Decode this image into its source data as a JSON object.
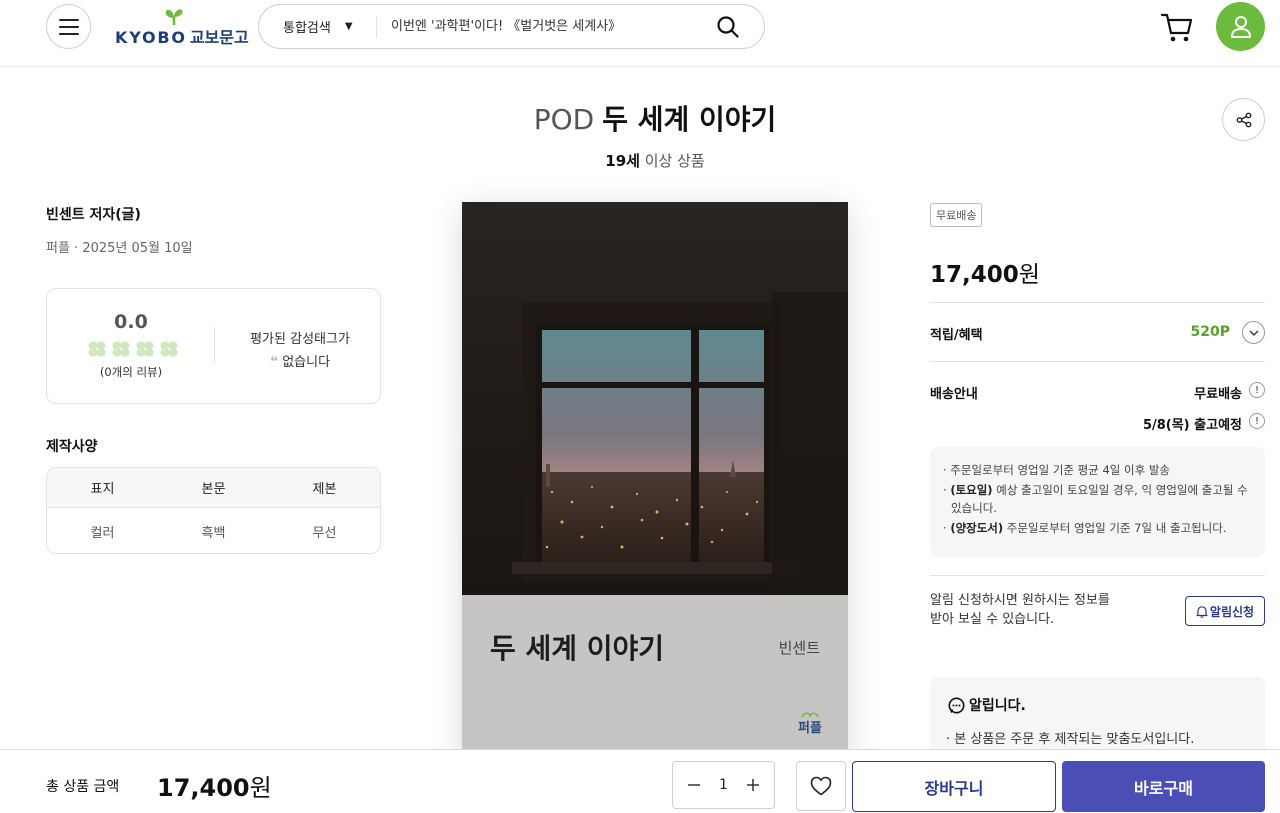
{
  "header": {
    "logo_text": "KYOBO",
    "logo_text_kr": "교보문고",
    "search_scope": "통합검색",
    "search_placeholder": "이번엔 '과학편'이다! 《벌거벗은 세계사》"
  },
  "product": {
    "prefix": "POD",
    "title": "두 세계 이야기",
    "age_bold": "19세",
    "age_rest": " 이상 상품",
    "author": "빈센트 저자(글)",
    "pub_info": "퍼플 · 2025년 05월 10일"
  },
  "rating": {
    "score": "0.0",
    "clover_count": 4,
    "review_count": "(0개의 리뷰)",
    "tag_line1": "평가된 감성태그가",
    "tag_line2": "없습니다"
  },
  "specs": {
    "title": "제작사양",
    "headers": [
      "표지",
      "본문",
      "제본"
    ],
    "values": [
      "컬러",
      "흑백",
      "무선"
    ]
  },
  "cover": {
    "title": "두 세계 이야기",
    "author": "빈센트",
    "publisher": "퍼플"
  },
  "purchase": {
    "free_badge": "무료배송",
    "price_num": "17,400",
    "price_unit": "원",
    "points_label": "적립/혜택",
    "points_value": "520P",
    "shipping_label": "배송안내",
    "shipping_type": "무료배송",
    "ship_date": "5/8(목) 출고예정",
    "ship_notes": [
      {
        "bold": "",
        "text": "· 주문일로부터 영업일 기준 평균 4일 이후 발송"
      },
      {
        "bold": "(토요일)",
        "text": " 예상 출고일이 토요일일 경우, 익 영업일에 출고될 수 있습니다."
      },
      {
        "bold": "(양장도서)",
        "text": " 주문일로부터 영업일 기준 7일 내 출고됩니다."
      }
    ],
    "alert_line1": "알림 신청하시면 원하시는 정보를",
    "alert_line2": "받아 보실 수 있습니다.",
    "alert_button": "알림신청",
    "notice_title": "알립니다.",
    "notice_body": "· 본 상품은 주문 후 제작되는 맞춤도서입니다."
  },
  "bottom_bar": {
    "total_label": "총 상품 금액",
    "total_num": "17,400",
    "total_unit": "원",
    "quantity": "1",
    "cart_button": "장바구니",
    "buy_button": "바로구매"
  },
  "colors": {
    "brand_green": "#6dbb3e",
    "brand_navy": "#2b3a8a",
    "buy_purple": "#4b4fb5",
    "points_green": "#5aa02c"
  }
}
